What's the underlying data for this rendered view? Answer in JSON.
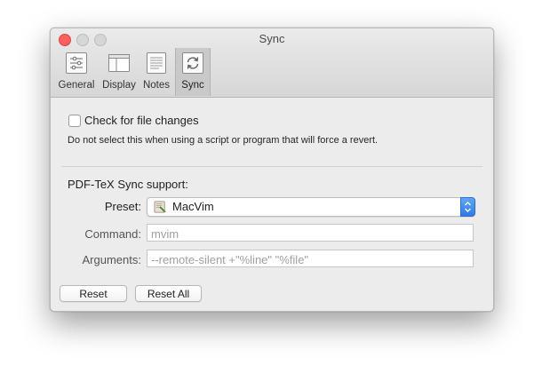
{
  "window": {
    "title": "Sync"
  },
  "toolbar": {
    "tabs": [
      {
        "label": "General",
        "icon": "sliders-icon"
      },
      {
        "label": "Display",
        "icon": "display-icon"
      },
      {
        "label": "Notes",
        "icon": "notes-icon"
      },
      {
        "label": "Sync",
        "icon": "sync-icon",
        "selected": true
      }
    ]
  },
  "file_changes": {
    "checkbox_label": "Check for file changes",
    "checked": false,
    "hint": "Do not select this when using a script or program that will force a revert."
  },
  "sync_support": {
    "heading": "PDF-TeX Sync support:",
    "preset_label": "Preset:",
    "preset_value": "MacVim",
    "command_label": "Command:",
    "command_placeholder": "mvim",
    "arguments_label": "Arguments:",
    "arguments_placeholder": "--remote-silent +\"%line\" \"%file\""
  },
  "buttons": {
    "reset": "Reset",
    "reset_all": "Reset All"
  },
  "colors": {
    "accent": "#2f79e8",
    "close": "#fc605c",
    "window_bg": "#ececec"
  }
}
